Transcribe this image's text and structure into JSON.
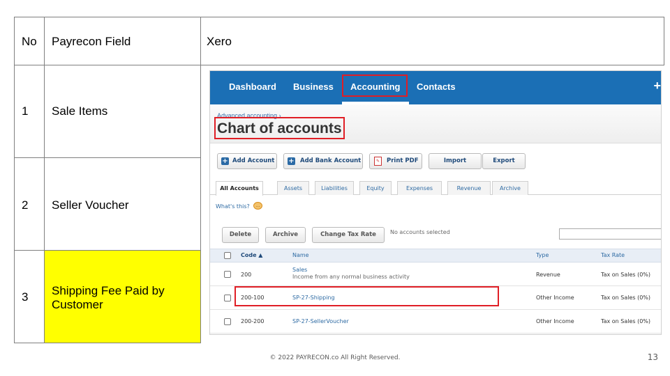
{
  "slide": {
    "headers": {
      "no": "No",
      "field": "Payrecon Field",
      "target": "Xero"
    },
    "rows": [
      {
        "no": "1",
        "field": "Sale Items"
      },
      {
        "no": "2",
        "field": "Seller Voucher"
      },
      {
        "no": "3",
        "field": "Shipping Fee Paid by Customer",
        "highlight": "#ffff00"
      }
    ],
    "footer": "© 2022 PAYRECON.co All Right Reserved.",
    "page_number": "13"
  },
  "xero": {
    "nav": {
      "items": [
        "Dashboard",
        "Business",
        "Accounting",
        "Contacts"
      ],
      "active": "Accounting",
      "plus": "+",
      "color": "#1b6fb5"
    },
    "breadcrumb": "Advanced accounting ›",
    "page_title": "Chart of accounts",
    "toolbar": {
      "add_account": "Add Account",
      "add_bank_account": "Add Bank Account",
      "print_pdf": "Print PDF",
      "import": "Import",
      "export": "Export"
    },
    "tabs": [
      "All Accounts",
      "Assets",
      "Liabilities",
      "Equity",
      "Expenses",
      "Revenue",
      "Archive"
    ],
    "active_tab": "All Accounts",
    "whats_this": "What's this?",
    "actions": {
      "delete": "Delete",
      "archive": "Archive",
      "change_tax_rate": "Change Tax Rate",
      "selection_status": "No accounts selected"
    },
    "grid": {
      "headers": {
        "code": "Code ▲",
        "name": "Name",
        "type": "Type",
        "tax_rate": "Tax Rate"
      },
      "rows": [
        {
          "code": "200",
          "name": "Sales",
          "description": "Income from any normal business activity",
          "type": "Revenue",
          "tax_rate": "Tax on Sales (0%)"
        },
        {
          "code": "200-100",
          "name": "SP-27-Shipping",
          "type": "Other Income",
          "tax_rate": "Tax on Sales (0%)"
        },
        {
          "code": "200-200",
          "name": "SP-27-SellerVoucher",
          "type": "Other Income",
          "tax_rate": "Tax on Sales (0%)"
        }
      ]
    },
    "highlight_color": "#e01e25"
  }
}
